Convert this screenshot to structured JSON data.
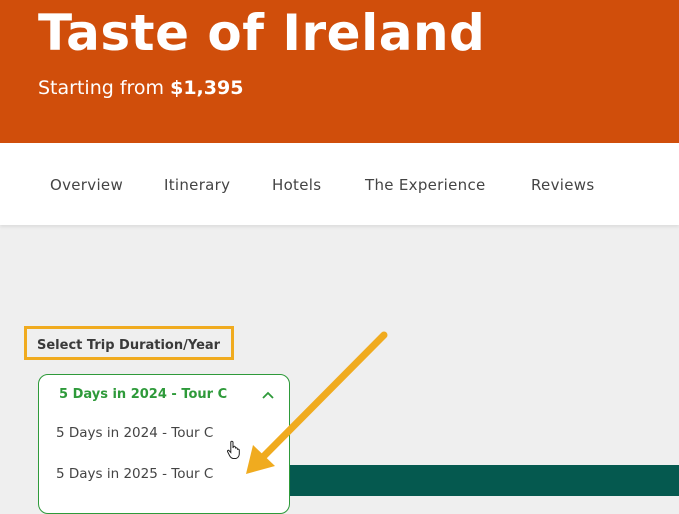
{
  "hero": {
    "title": "Taste of Ireland",
    "subtitle_prefix": "Starting from",
    "price": "$1,395",
    "background": "#d04e0b"
  },
  "nav": {
    "items": [
      {
        "label": "Overview"
      },
      {
        "label": "Itinerary"
      },
      {
        "label": "Hotels"
      },
      {
        "label": "The Experience"
      },
      {
        "label": "Reviews"
      }
    ]
  },
  "trip_select": {
    "label": "Select Trip Duration/Year",
    "selected": "5 Days in 2024 - Tour C",
    "options": [
      "5 Days in 2024 - Tour C",
      "5 Days in 2025 - Tour C"
    ],
    "accent": "#2e9a3a"
  },
  "annotation": {
    "highlight_color": "#f0ab1f",
    "icons": [
      "arrow-annotation",
      "hand-pointer-cursor"
    ]
  }
}
